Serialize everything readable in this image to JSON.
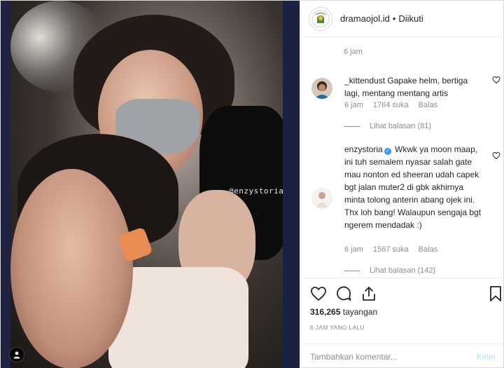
{
  "media": {
    "watermark": "@enzystoria"
  },
  "header": {
    "username": "dramaojol.id",
    "separator": "•",
    "follow_status": "Diikuti"
  },
  "comments": {
    "top_time": "6 jam",
    "items": [
      {
        "username": "_kittendust",
        "text": "Gapake helm, bertiga lagi, mentang mentang artis",
        "time": "6 jam",
        "likes": "1764 suka",
        "reply_label": "Balas",
        "view_replies": "Lihat balasan (81)"
      },
      {
        "username": "enzystoria",
        "verified": true,
        "text": "Wkwk ya moon maap, ini tuh semalem nyasar salah gate mau nonton ed sheeran udah capek bgt jalan muter2 di gbk akhirnya minta tolong anterin abang ojek ini. Thx loh bang! Walaupun sengaja bgt ngerem mendadak :)",
        "time": "6 jam",
        "likes": "1567 suka",
        "reply_label": "Balas",
        "view_replies": "Lihat balasan (142)"
      }
    ]
  },
  "actions": {
    "views_count": "316,265",
    "views_label": "tayangan",
    "posted_ago": "6 JAM YANG LALU"
  },
  "add_comment": {
    "placeholder": "Tambahkan komentar...",
    "post_label": "Kirim"
  },
  "colors": {
    "link_blue": "#3897f0",
    "muted": "#8e8e8e",
    "post_disabled": "#b2dffc"
  }
}
